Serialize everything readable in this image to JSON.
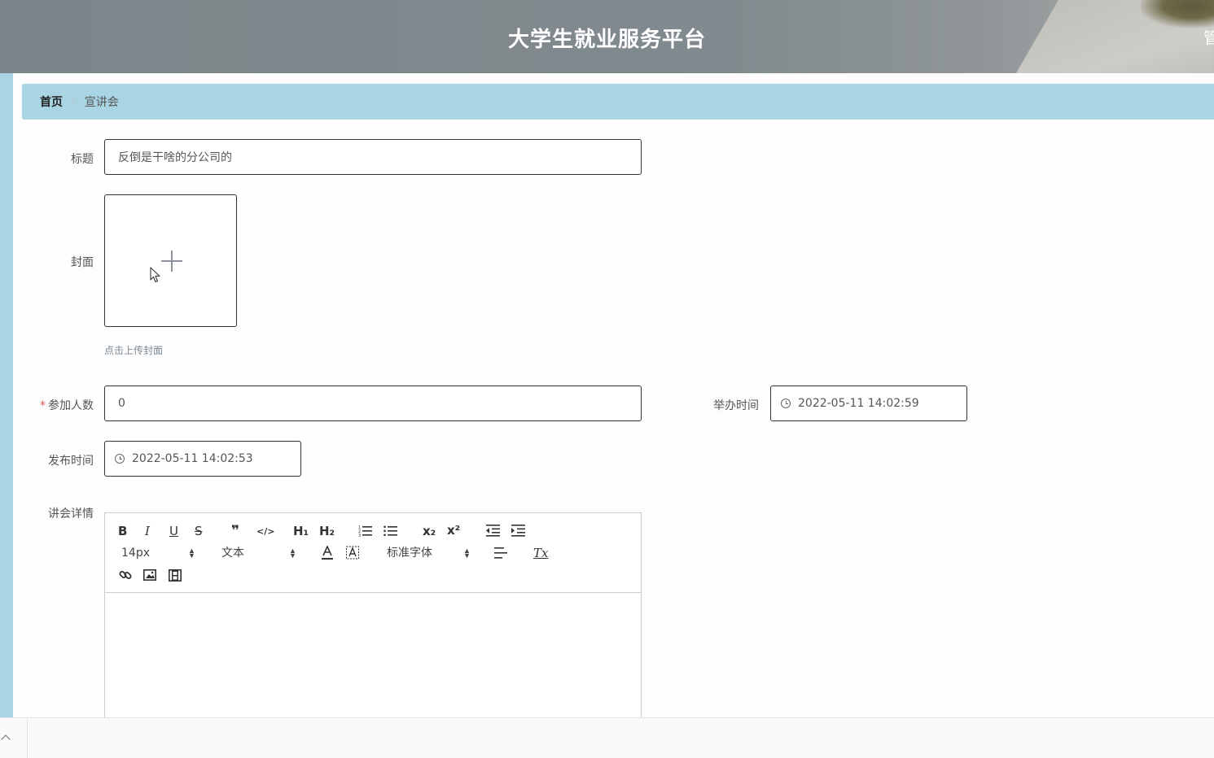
{
  "header": {
    "title": "大学生就业服务平台",
    "admin": "管"
  },
  "breadcrumb": {
    "home": "首页",
    "separator": "/",
    "current": "宣讲会"
  },
  "form": {
    "title": {
      "label": "标题",
      "value": "反倒是干啥的分公司的"
    },
    "cover": {
      "label": "封面",
      "tip": "点击上传封面"
    },
    "participants": {
      "required_mark": "*",
      "label": "参加人数",
      "value": "0"
    },
    "hold_time": {
      "label": "举办时间",
      "value": "2022-05-11 14:02:59"
    },
    "publish_time": {
      "label": "发布时间",
      "value": "2022-05-11 14:02:53"
    },
    "details": {
      "label": "讲会详情"
    }
  },
  "editor": {
    "bold": "B",
    "italic": "I",
    "underline": "U",
    "strike": "S",
    "quote": "❞",
    "code": "</>",
    "h1": "H₁",
    "h2": "H₂",
    "subscript": "x₂",
    "superscript": "x²",
    "size": "14px",
    "header_select": "文本",
    "font": "标准字体",
    "clean": "Tx"
  },
  "colors": {
    "header_bg": "#7f888c",
    "breadcrumb_bg": "#a8d4e3",
    "required": "#e05252"
  }
}
